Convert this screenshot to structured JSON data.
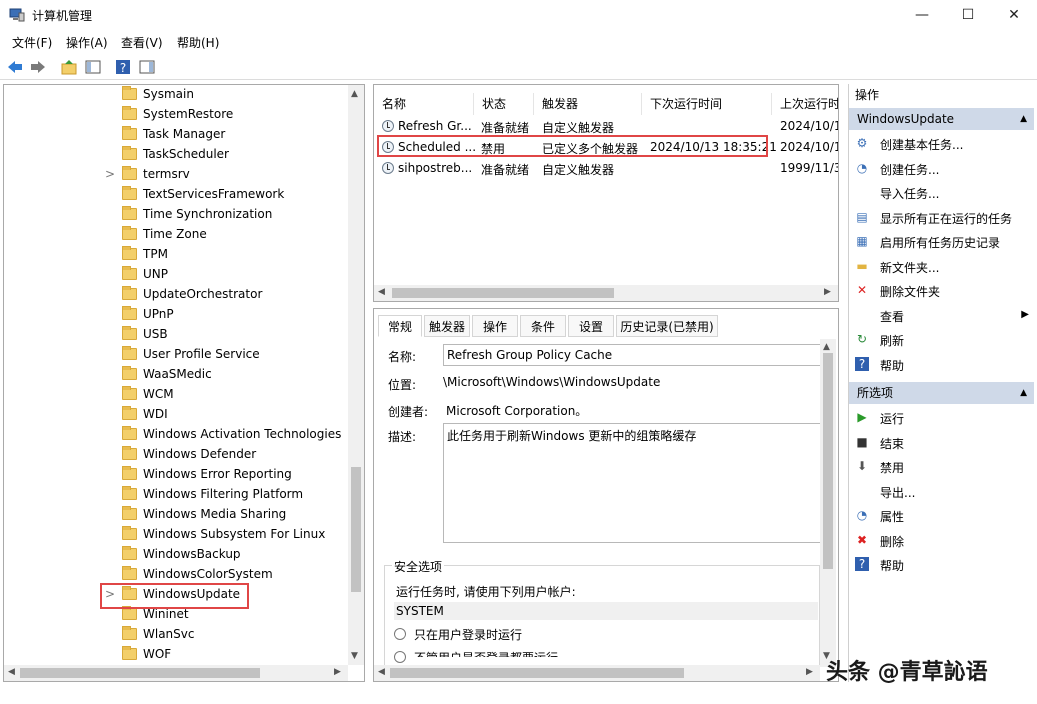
{
  "window": {
    "title": "计算机管理",
    "minimize": "—",
    "maximize": "☐",
    "close": "✕"
  },
  "menu": [
    "文件(F)",
    "操作(A)",
    "查看(V)",
    "帮助(H)"
  ],
  "tree": {
    "items": [
      {
        "label": "Sysmain"
      },
      {
        "label": "SystemRestore"
      },
      {
        "label": "Task Manager"
      },
      {
        "label": "TaskScheduler"
      },
      {
        "label": "termsrv",
        "chevron": ">"
      },
      {
        "label": "TextServicesFramework"
      },
      {
        "label": "Time Synchronization"
      },
      {
        "label": "Time Zone"
      },
      {
        "label": "TPM"
      },
      {
        "label": "UNP"
      },
      {
        "label": "UpdateOrchestrator"
      },
      {
        "label": "UPnP"
      },
      {
        "label": "USB"
      },
      {
        "label": "User Profile Service"
      },
      {
        "label": "WaaSMedic"
      },
      {
        "label": "WCM"
      },
      {
        "label": "WDI"
      },
      {
        "label": "Windows Activation Technologies"
      },
      {
        "label": "Windows Defender"
      },
      {
        "label": "Windows Error Reporting"
      },
      {
        "label": "Windows Filtering Platform"
      },
      {
        "label": "Windows Media Sharing"
      },
      {
        "label": "Windows Subsystem For Linux"
      },
      {
        "label": "WindowsBackup"
      },
      {
        "label": "WindowsColorSystem"
      },
      {
        "label": "WindowsUpdate",
        "chevron": ">"
      },
      {
        "label": "Wininet"
      },
      {
        "label": "WlanSvc"
      },
      {
        "label": "WOF"
      }
    ]
  },
  "tasks": {
    "columns": [
      "名称",
      "状态",
      "触发器",
      "下次运行时间",
      "上次运行时"
    ],
    "rows": [
      {
        "name": "Refresh Gr...",
        "status": "准备就绪",
        "trigger": "自定义触发器",
        "next": "",
        "last": "2024/10/1"
      },
      {
        "name": "Scheduled ...",
        "status": "禁用",
        "trigger": "已定义多个触发器",
        "next": "2024/10/13 18:35:21",
        "last": "2024/10/1"
      },
      {
        "name": "sihpostreb...",
        "status": "准备就绪",
        "trigger": "自定义触发器",
        "next": "",
        "last": "1999/11/3"
      }
    ]
  },
  "details": {
    "tabs": [
      "常规",
      "触发器",
      "操作",
      "条件",
      "设置",
      "历史记录(已禁用)"
    ],
    "name_label": "名称:",
    "name_value": "Refresh Group Policy Cache",
    "location_label": "位置:",
    "location_value": "\\Microsoft\\Windows\\WindowsUpdate",
    "author_label": "创建者:",
    "author_value": "Microsoft Corporation。",
    "desc_label": "描述:",
    "desc_value": "此任务用于刷新Windows 更新中的组策略缓存",
    "security_title": "安全选项",
    "run_as_label": "运行任务时, 请使用下列用户帐户:",
    "run_as_value": "SYSTEM",
    "radio1": "只在用户登录时运行",
    "radio2": "不管用户是否登录都要运行"
  },
  "actions": {
    "header": "操作",
    "section1": "WindowsUpdate",
    "items1": [
      {
        "icon": "create-basic-task-icon",
        "glyph": "⚙",
        "label": "创建基本任务..."
      },
      {
        "icon": "create-task-icon",
        "glyph": "◔",
        "label": "创建任务..."
      },
      {
        "icon": "",
        "glyph": "",
        "label": "导入任务..."
      },
      {
        "icon": "running-tasks-icon",
        "glyph": "▤",
        "label": "显示所有正在运行的任务"
      },
      {
        "icon": "history-icon",
        "glyph": "▦",
        "label": "启用所有任务历史记录"
      },
      {
        "icon": "new-folder-icon",
        "glyph": "▬",
        "label": "新文件夹..."
      },
      {
        "icon": "delete-folder-icon",
        "glyph": "✕",
        "label": "删除文件夹"
      },
      {
        "icon": "",
        "glyph": "",
        "label": "查看",
        "submenu": "▶"
      },
      {
        "icon": "refresh-icon",
        "glyph": "↻",
        "label": "刷新"
      },
      {
        "icon": "help-icon",
        "glyph": "?",
        "label": "帮助"
      }
    ],
    "section2": "所选项",
    "items2": [
      {
        "icon": "run-icon",
        "glyph": "▶",
        "label": "运行"
      },
      {
        "icon": "end-icon",
        "glyph": "■",
        "label": "结束"
      },
      {
        "icon": "disable-icon",
        "glyph": "⬇",
        "label": "禁用"
      },
      {
        "icon": "",
        "glyph": "",
        "label": "导出..."
      },
      {
        "icon": "properties-icon",
        "glyph": "◔",
        "label": "属性"
      },
      {
        "icon": "delete-icon",
        "glyph": "✖",
        "label": "删除"
      },
      {
        "icon": "help-icon",
        "glyph": "?",
        "label": "帮助"
      }
    ]
  },
  "watermark": "头条 @青草訫语",
  "colors": {
    "highlight": "#e04646",
    "section_bg": "#cfd9e8"
  }
}
